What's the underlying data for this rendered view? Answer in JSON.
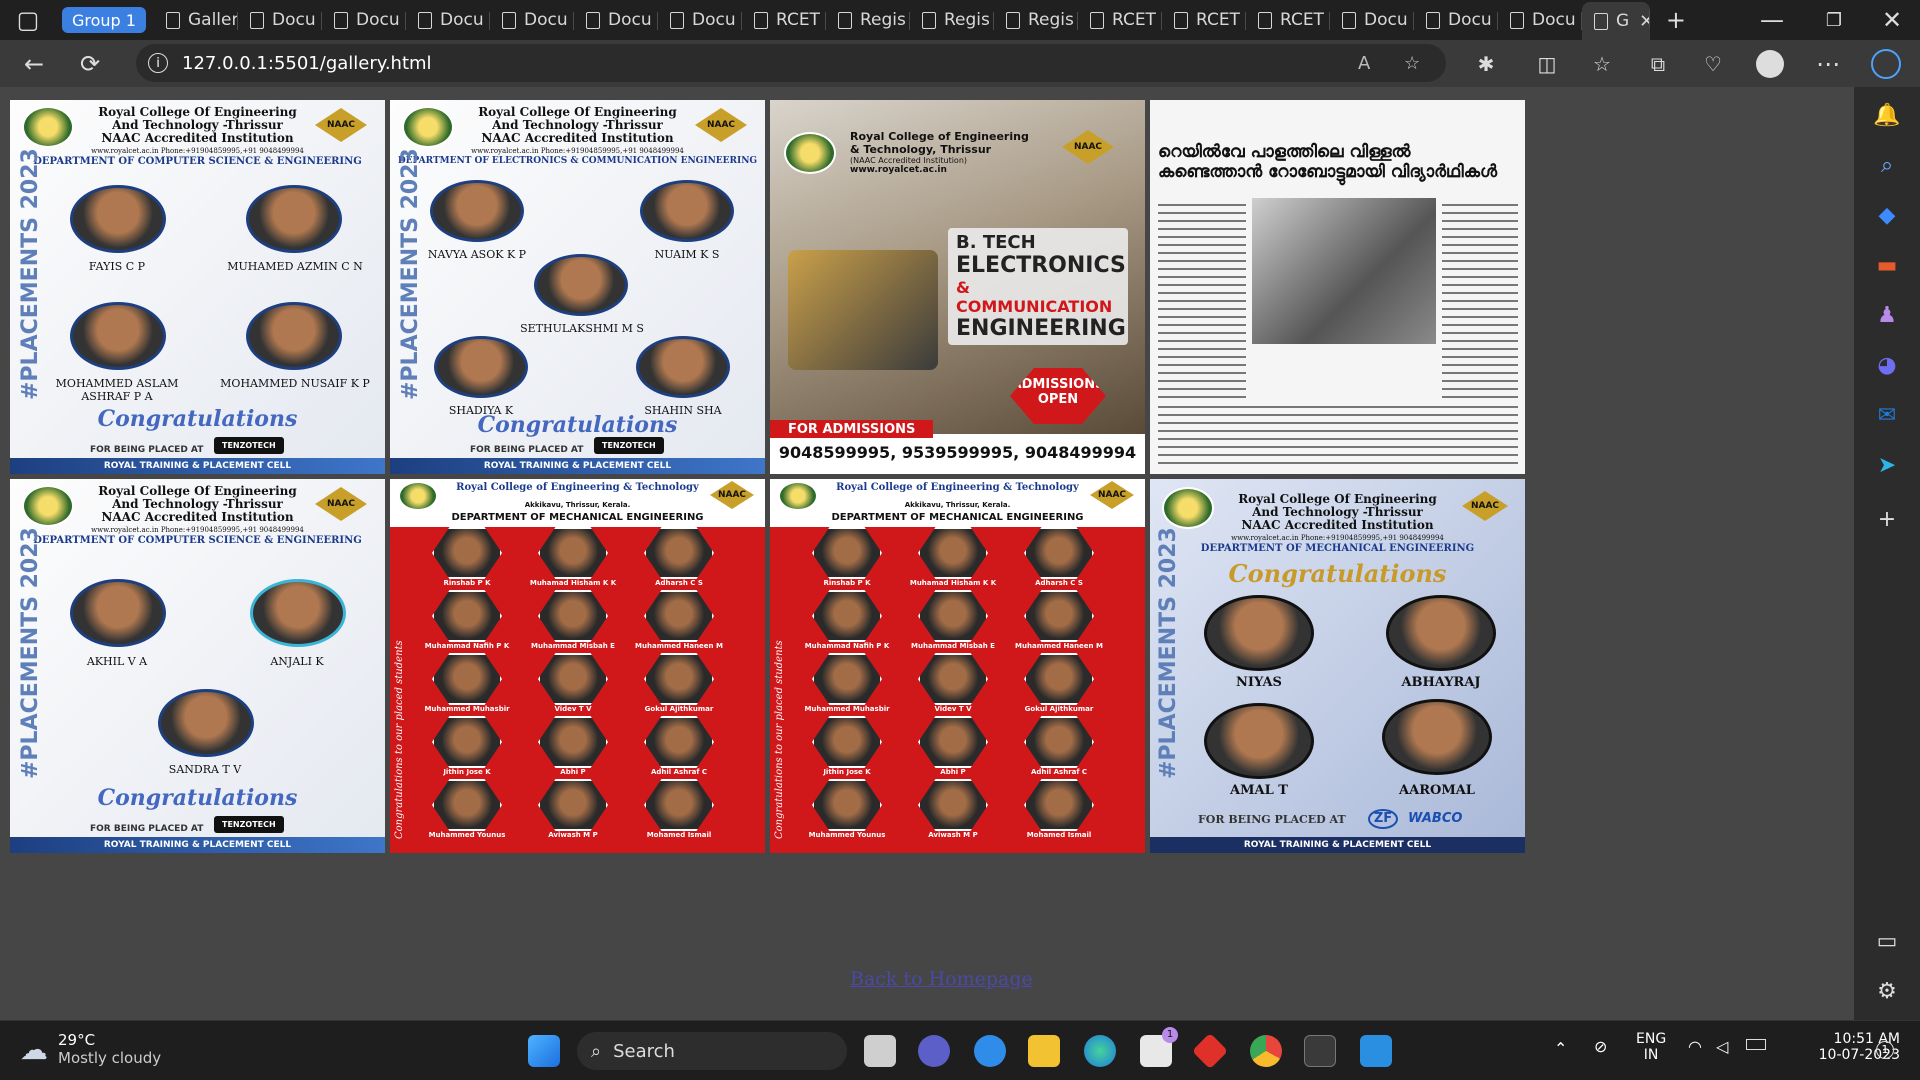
{
  "browser": {
    "group_label": "Group 1",
    "tabs": [
      "Galler",
      "Docu",
      "Docu",
      "Docu",
      "Docu",
      "Docu",
      "Docu",
      "RCET",
      "Regis",
      "Regis",
      "Regis",
      "RCET",
      "RCET",
      "RCET",
      "Docu",
      "Docu",
      "Docu"
    ],
    "active_tab": "G",
    "url": "127.0.0.1:5501/gallery.html"
  },
  "posters": {
    "college": "Royal College Of Engineering And Technology -Thrissur",
    "naac": "NAAC Accredited Institution",
    "web": "www.royalcet.ac.in Phone:+91904859995,+91 9048499994",
    "cse_dept": "DEPARTMENT OF COMPUTER SCIENCE & ENGINEERING",
    "ece_dept": "DEPARTMENT OF ELECTRONICS & COMMUNICATION ENGINEERING",
    "mech_dept": "DEPARTMENT OF MECHANICAL ENGINEERING",
    "placements": "#PLACEMENTS 2023",
    "congrats": "Congratulations",
    "placed_at": "FOR BEING PLACED AT",
    "tenzo": "TENZOTECH",
    "cell": "ROYAL TRAINING & PLACEMENT CELL",
    "p1_names": [
      "FAYIS C P",
      "MUHAMED AZMIN C N",
      "MOHAMMED ASLAM ASHRAF P A",
      "MOHAMMED NUSAIF K P"
    ],
    "p2_names": [
      "NAVYA ASOK K P",
      "NUAIM K S",
      "SETHULAKSHMI M S",
      "SHADIYA K",
      "SHAHIN SHA"
    ],
    "p3": {
      "college": "Royal College of Engineering & Technology, Thrissur",
      "naac": "(NAAC Accredited Institution)",
      "web": "www.royalcet.ac.in",
      "line1": "B. TECH",
      "line2": "ELECTRONICS",
      "line3": "& COMMUNICATION",
      "line4": "ENGINEERING",
      "badge": "ADMISSIONS OPEN",
      "for_adm": "FOR ADMISSIONS",
      "phones": "9048599995, 9539599995, 9048499994"
    },
    "p4_headline": "റെയിൽവേ പാളത്തിലെ വിള്ളൽ കണ്ടെത്താൻ റോബോട്ടുമായി വിദ്യാർഥികൾ",
    "p5_names": [
      "AKHIL V A",
      "ANJALI K",
      "SANDRA T V"
    ],
    "mech_red_college": "Royal College of Engineering & Technology",
    "mech_red_loc": "Akkikavu, Thrissur, Kerala.",
    "mech_red_side": "Congratulations to our placed students",
    "mech_red_names": [
      "Rinshab P K",
      "Muhamad Hisham K K",
      "Adharsh C S",
      "Muhammad Nafih P K",
      "Muhammad Misbah E",
      "Muhammed Haneen M",
      "Muhammed Muhasbir",
      "Videv T V",
      "Gokul Ajithkumar",
      "Jithin Jose K",
      "Abhi P",
      "Adhil Ashraf C",
      "Muhammed Younus",
      "Aviwash M P",
      "Mohamed Ismail"
    ],
    "p8_names": [
      "NIYAS",
      "ABHAYRAJ",
      "AMAL T",
      "AAROMAL"
    ],
    "p8_companies": [
      "ZF",
      "WABCO"
    ]
  },
  "back_link": "Back to Homepage",
  "taskbar": {
    "temp": "29°C",
    "weather": "Mostly cloudy",
    "search": "Search",
    "lang1": "ENG",
    "lang2": "IN",
    "time": "10:51 AM",
    "date": "10-07-2023",
    "badge": "1",
    "store_badge": "1"
  }
}
